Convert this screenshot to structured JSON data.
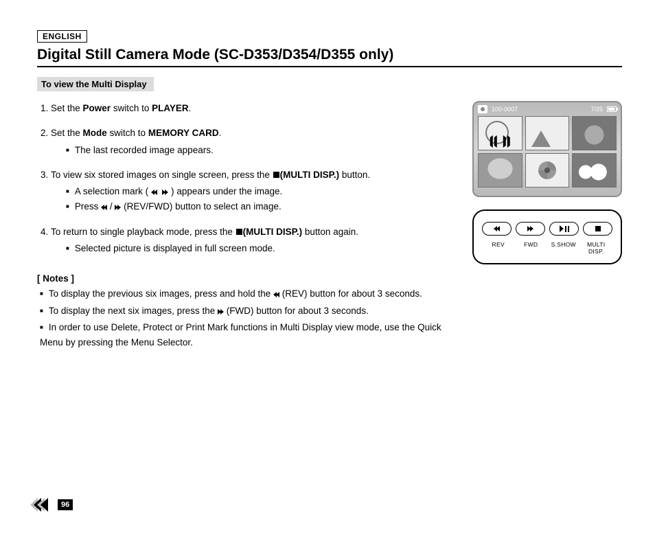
{
  "language": "ENGLISH",
  "title": "Digital Still Camera Mode (SC-D353/D354/D355 only)",
  "section": "To view the Multi Display",
  "steps": [
    {
      "text_parts": [
        "Set the ",
        "Power",
        " switch to ",
        "PLAYER",
        "."
      ],
      "subs": []
    },
    {
      "text_parts": [
        "Set the ",
        "Mode",
        " switch to ",
        "MEMORY CARD",
        "."
      ],
      "subs": [
        "The last recorded image appears."
      ]
    },
    {
      "text_parts": [
        "To view six stored images on single screen, press the ",
        "",
        "(MULTI DISP.)",
        " button."
      ],
      "subs": [
        "A selection mark (  REW  FWD  ) appears under the image.",
        "Press  REW / FWD (REV/FWD) button to select an image."
      ]
    },
    {
      "text_parts": [
        "To return to single playback mode, press the ",
        "",
        "(MULTI DISP.)",
        " button again."
      ],
      "subs": [
        "Selected picture is displayed in full screen mode."
      ]
    }
  ],
  "notes_label": "[ Notes ]",
  "notes": [
    "To display the previous six images, press and hold the  REW (REV) button for about 3 seconds.",
    "To display the next six images, press the  FWD (FWD) button for about 3 seconds.",
    "In order to use Delete, Protect or Print Mark functions in Multi Display view mode, use the Quick Menu by pressing the Menu Selector."
  ],
  "screen": {
    "file_number": "100-0007",
    "index": "7/25"
  },
  "buttons": {
    "labels": [
      "REV",
      "FWD",
      "S.SHOW",
      "MULTI DISP."
    ]
  },
  "page_number": "96"
}
